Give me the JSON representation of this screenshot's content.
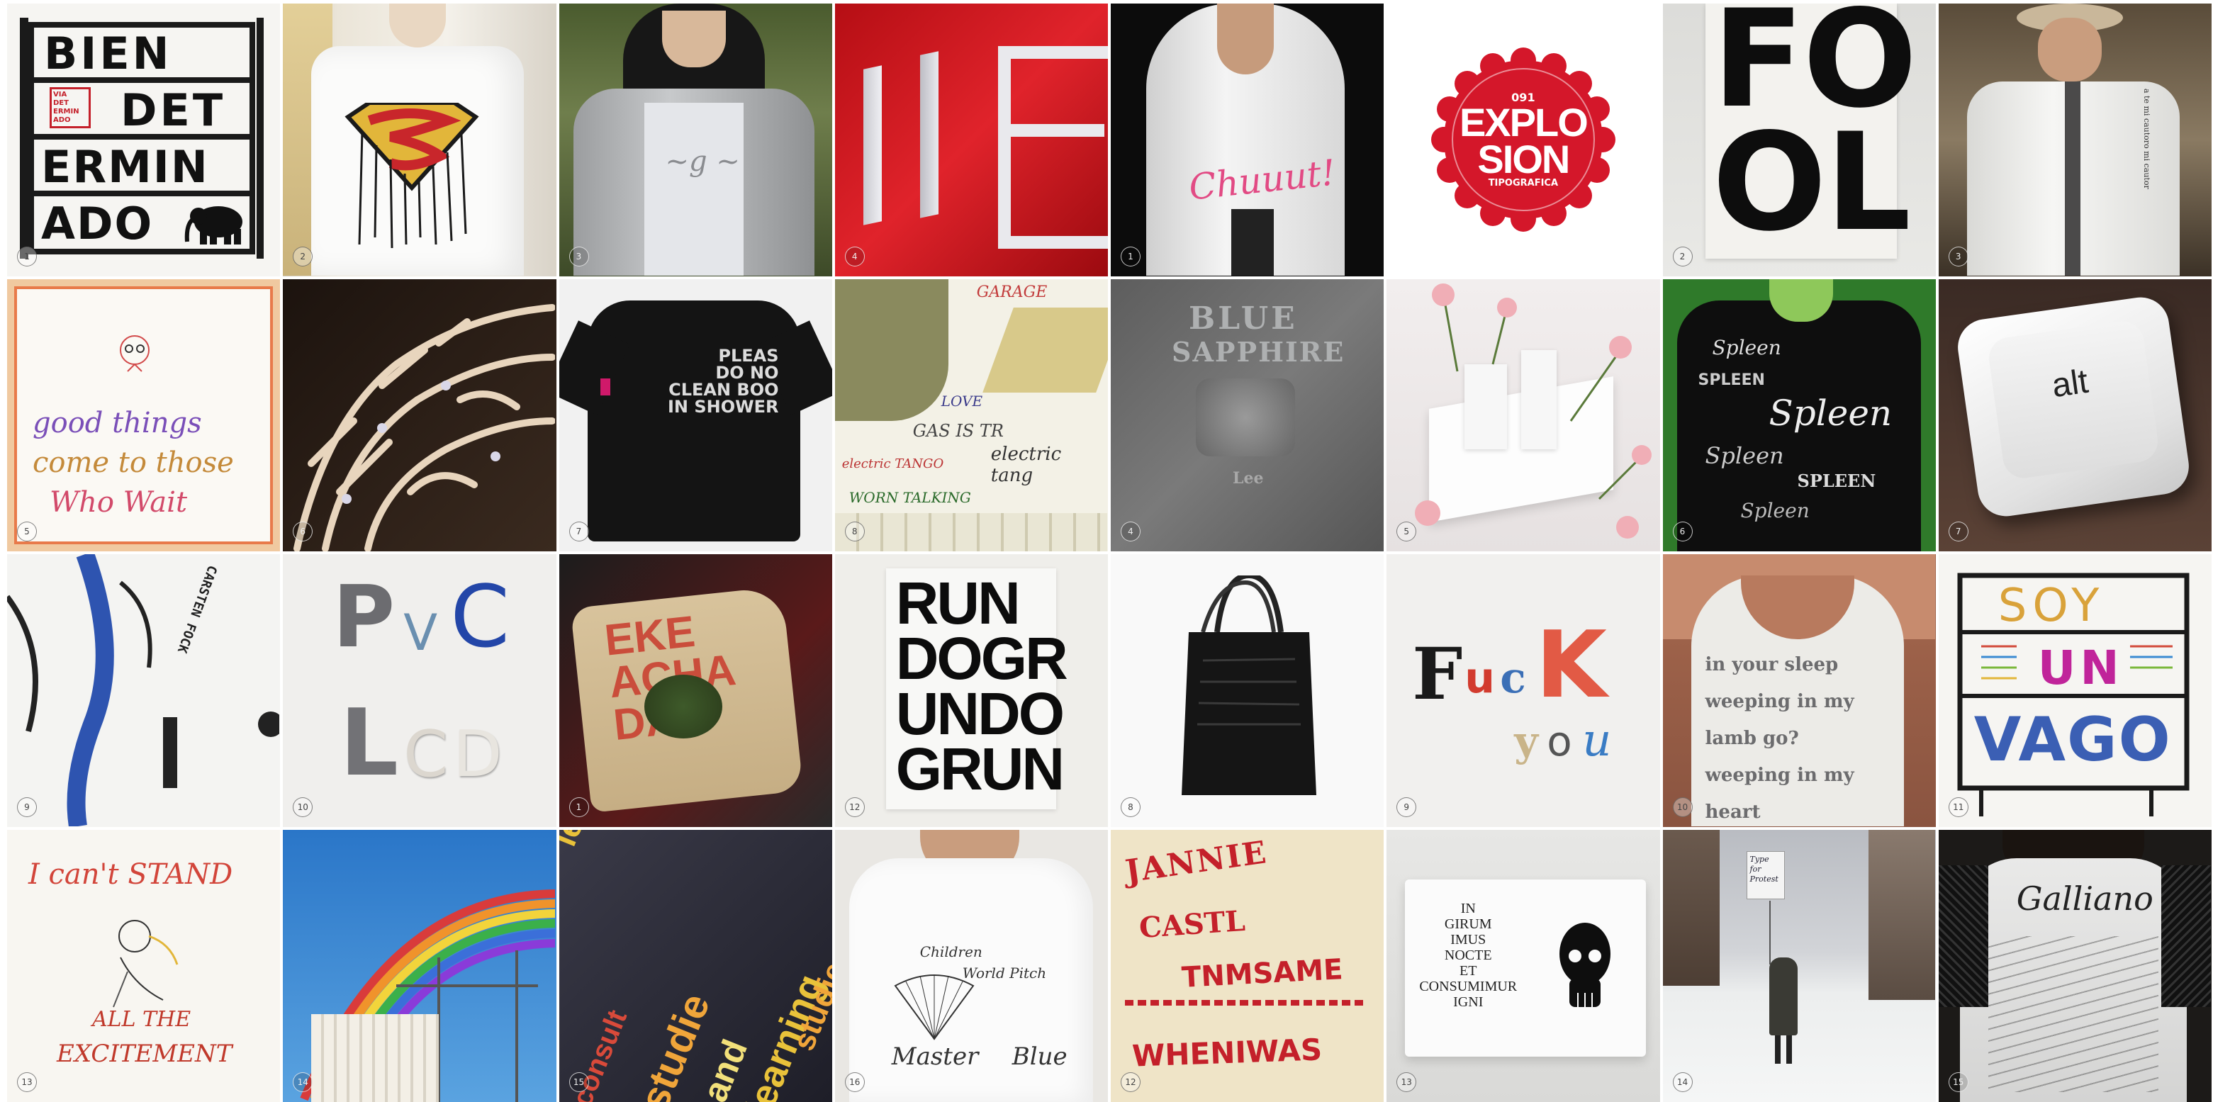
{
  "tiles": [
    {
      "id": 1,
      "num": "1",
      "lines": [
        "BIEN",
        "DET",
        "ERMIN",
        "ADO"
      ],
      "stamp": [
        "VIA",
        "DET",
        "ERMIN",
        "ADO"
      ]
    },
    {
      "id": 2,
      "num": "2"
    },
    {
      "id": 3,
      "num": "3"
    },
    {
      "id": 4,
      "num": "4"
    },
    {
      "id": 5,
      "num": "1",
      "text": "Chuuut!"
    },
    {
      "id": 6,
      "badge": {
        "num": "091",
        "line1": "EXPLO",
        "line2": "SION",
        "sub": "TIPOGRAFICA"
      }
    },
    {
      "id": 7,
      "num": "2",
      "lines": [
        "FO",
        "OL"
      ]
    },
    {
      "id": 8,
      "num": "3",
      "tie_text": "a te mi cautoro mi cautor"
    },
    {
      "id": 9,
      "num": "5",
      "lines": [
        "good things",
        "come to those",
        "Who Wait"
      ]
    },
    {
      "id": 10,
      "num": "6"
    },
    {
      "id": 11,
      "num": "7",
      "lines": [
        "PLEAS",
        "DO NO",
        "CLEAN BOO",
        "IN SHOWER"
      ]
    },
    {
      "id": 12,
      "num": "8",
      "scribbles": [
        "GARAGE",
        "GAS IS TR",
        "electric tang",
        "electric TANGO",
        "WORN TALKING",
        "LOVE"
      ]
    },
    {
      "id": 13,
      "num": "4",
      "lines": [
        "BLUE",
        "SAPPHIRE",
        "Lee"
      ]
    },
    {
      "id": 14,
      "num": "5"
    },
    {
      "id": 15,
      "num": "6",
      "words": [
        "Spleen",
        "SPLEEN",
        "Spleen",
        "Spleen",
        "SPLEEN",
        "Spleen"
      ]
    },
    {
      "id": 16,
      "num": "7",
      "key": "alt"
    },
    {
      "id": 17,
      "num": "9",
      "text": "CARSTEN FOCK"
    },
    {
      "id": 18,
      "num": "10",
      "letters": [
        "P",
        "V",
        "C",
        "L",
        "C",
        "D"
      ]
    },
    {
      "id": 19,
      "num": "1",
      "text": "EKE ACHA DA"
    },
    {
      "id": 20,
      "num": "12",
      "lines": [
        "RUN",
        "DOGR",
        "UNDO",
        "GRUN"
      ]
    },
    {
      "id": 21,
      "num": "8"
    },
    {
      "id": 22,
      "num": "9",
      "line1": [
        "F",
        "u",
        "c",
        "K"
      ],
      "line2": [
        "y",
        "o",
        "u"
      ]
    },
    {
      "id": 23,
      "num": "10",
      "lines": [
        "in your sleep",
        "weeping in my",
        "lamb go?",
        "weeping in my heart"
      ]
    },
    {
      "id": 24,
      "num": "11",
      "lines": [
        "SOY",
        "UN",
        "VAGO"
      ]
    },
    {
      "id": 25,
      "num": "13",
      "lines": [
        "I can't STAND",
        "ALL THE",
        "EXCITEMENT"
      ]
    },
    {
      "id": 26,
      "num": "14"
    },
    {
      "id": 27,
      "num": "15",
      "words": [
        "learning",
        "studie",
        "consult",
        "and",
        "learning",
        "studie"
      ]
    },
    {
      "id": 28,
      "num": "16",
      "words": [
        "Children",
        "World Pitch",
        "Master",
        "Blue"
      ]
    },
    {
      "id": 29,
      "num": "12",
      "words": [
        "JANNIE",
        "CASTL",
        "TNMSAME",
        "WHENIWAS"
      ]
    },
    {
      "id": 30,
      "num": "13",
      "lines": [
        "IN",
        "GIRUM",
        "IMUS",
        "NOCTE",
        "ET",
        "CONSUMIMUR",
        "IGNI"
      ]
    },
    {
      "id": 31,
      "num": "14",
      "sign": [
        "Type",
        "for",
        "Protest"
      ]
    },
    {
      "id": 32,
      "num": "15",
      "text": "Galliano"
    }
  ],
  "colors": {
    "red": "#d4172a",
    "shirtBlack": "#151515",
    "paper": "#f1efec"
  }
}
